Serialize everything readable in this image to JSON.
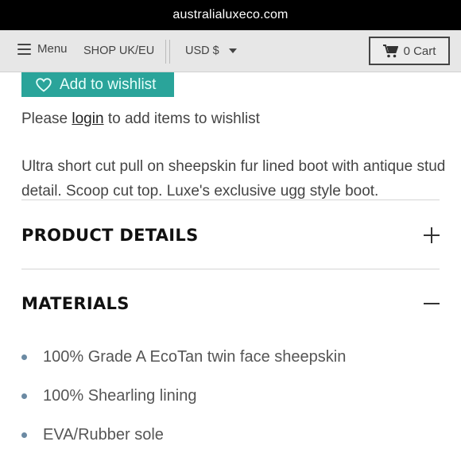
{
  "status_bar": {
    "url": "australialuxeco.com"
  },
  "nav": {
    "menu_label": "Menu",
    "shop_link": "SHOP UK/EU",
    "currency": "USD $",
    "cart_label": "0 Cart"
  },
  "wishlist": {
    "button_label": "Add to wishlist",
    "note_prefix": "Please",
    "note_link": "login",
    "note_suffix": "to add items to wishlist"
  },
  "description": "Ultra short cut pull on sheepskin fur lined boot with antique stud detail.  Scoop cut top.  Luxe's exclusive ugg style boot.",
  "sections": {
    "product_details": {
      "title": "PRODUCT DETAILS",
      "state": "collapsed"
    },
    "materials": {
      "title": "MATERIALS",
      "state": "expanded",
      "items": [
        "100% Grade A EcoTan twin face sheepskin",
        "100% Shearling lining",
        "EVA/Rubber sole"
      ]
    }
  },
  "colors": {
    "accent": "#2aa49a",
    "nav_bg": "#e7e7e7",
    "bullet": "#6b8aa3"
  },
  "icons": {
    "menu": "hamburger-icon",
    "currency": "caret-down-icon",
    "cart": "cart-icon",
    "wishlist": "heart-icon",
    "expand": "plus-icon",
    "collapse": "minus-icon"
  }
}
